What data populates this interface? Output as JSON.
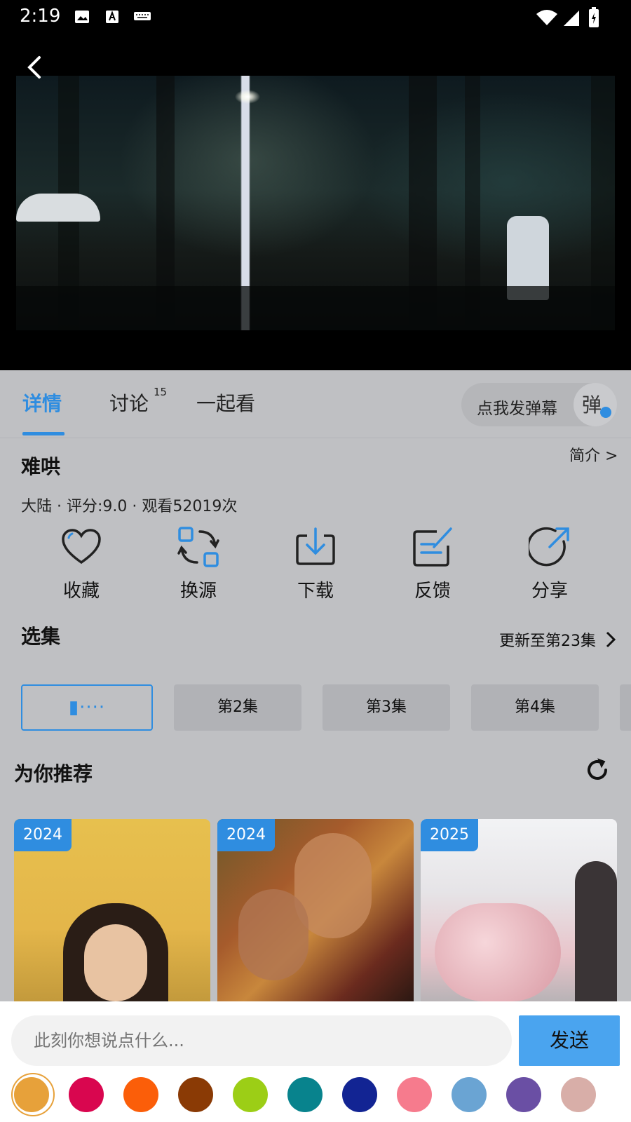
{
  "status_bar": {
    "time": "2:19"
  },
  "tabs": {
    "detail": "详情",
    "discuss": "讨论",
    "discuss_count": "15",
    "together": "一起看",
    "danmaku_prompt": "点我发弹幕",
    "danmaku_toggle": "弹"
  },
  "show": {
    "title": "难哄",
    "intro_link": "简介 >",
    "meta": "大陆 · 评分:9.0 · 观看52019次"
  },
  "actions": [
    {
      "label": "收藏",
      "icon": "heart-icon"
    },
    {
      "label": "换源",
      "icon": "switch-source-icon"
    },
    {
      "label": "下载",
      "icon": "download-icon"
    },
    {
      "label": "反馈",
      "icon": "feedback-icon"
    },
    {
      "label": "分享",
      "icon": "share-icon"
    }
  ],
  "episodes": {
    "title": "选集",
    "update": "更新至第23集",
    "items": [
      "第2集",
      "第3集",
      "第4集"
    ]
  },
  "recommend": {
    "title": "为你推荐",
    "posters": [
      {
        "year": "2024"
      },
      {
        "year": "2024"
      },
      {
        "year": "2025"
      }
    ]
  },
  "comment": {
    "placeholder": "此刻你想说点什么...",
    "send": "发送"
  },
  "colors": {
    "accent": "#2f8de0",
    "send_button": "#4aa4ef",
    "swatches": [
      "#e7a13a",
      "#d9064f",
      "#fb5e09",
      "#8a3a05",
      "#9cce16",
      "#08838d",
      "#122493",
      "#f67b8d",
      "#6aa4d3",
      "#6a4fa4",
      "#d8aea8"
    ]
  }
}
